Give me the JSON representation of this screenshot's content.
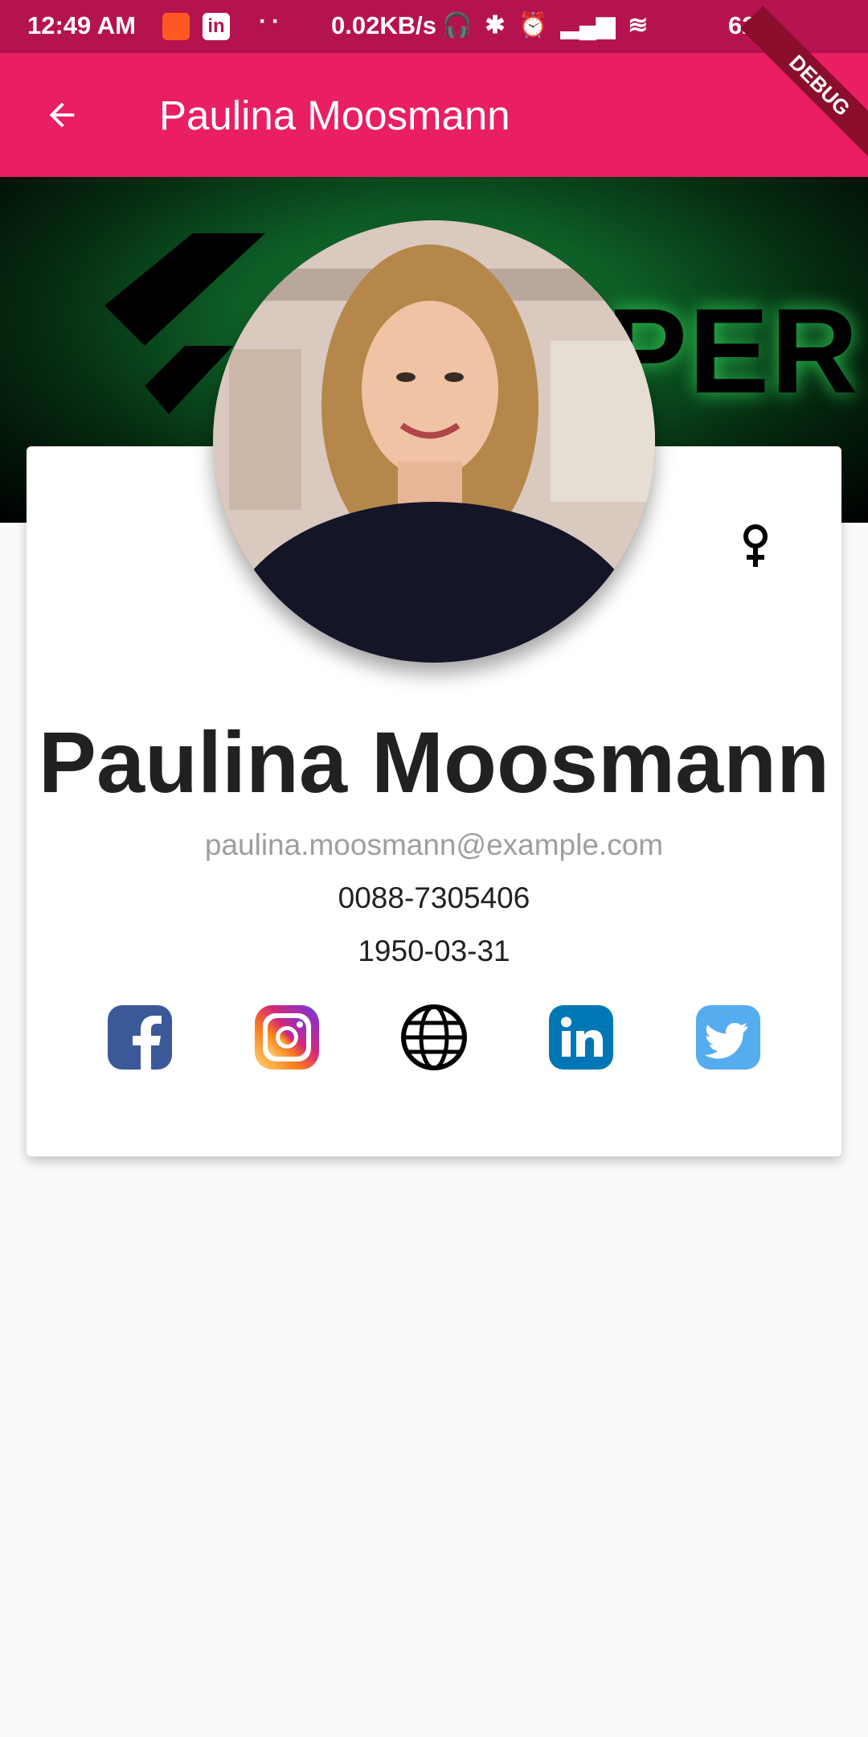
{
  "status_bar": {
    "time": "12:49 AM",
    "speed": "0.02KB/s",
    "battery": "62%",
    "icons": [
      "headphones-icon",
      "bluetooth-icon",
      "alarm-icon",
      "signal-icon",
      "volte-icon",
      "signal-icon",
      "wifi-icon",
      "battery-icon"
    ]
  },
  "app_bar": {
    "title": "Paulina Moosmann",
    "back_icon": "arrow-back-icon",
    "debug_label": "DEBUG"
  },
  "cover": {
    "text": "PER"
  },
  "profile": {
    "name": "Paulina Moosmann",
    "email": "paulina.moosmann@example.com",
    "phone": "0088-7305406",
    "dob": "1950-03-31",
    "gender_icon": "female-icon"
  },
  "social": [
    {
      "name": "facebook-icon",
      "color": "#3b5998"
    },
    {
      "name": "instagram-icon",
      "color": "#d62976"
    },
    {
      "name": "globe-icon",
      "color": "#000000"
    },
    {
      "name": "linkedin-icon",
      "color": "#0077b5"
    },
    {
      "name": "twitter-icon",
      "color": "#55acee"
    }
  ],
  "colors": {
    "status_bar": "#b5134f",
    "app_bar": "#e91e63",
    "background": "#fafafa"
  }
}
